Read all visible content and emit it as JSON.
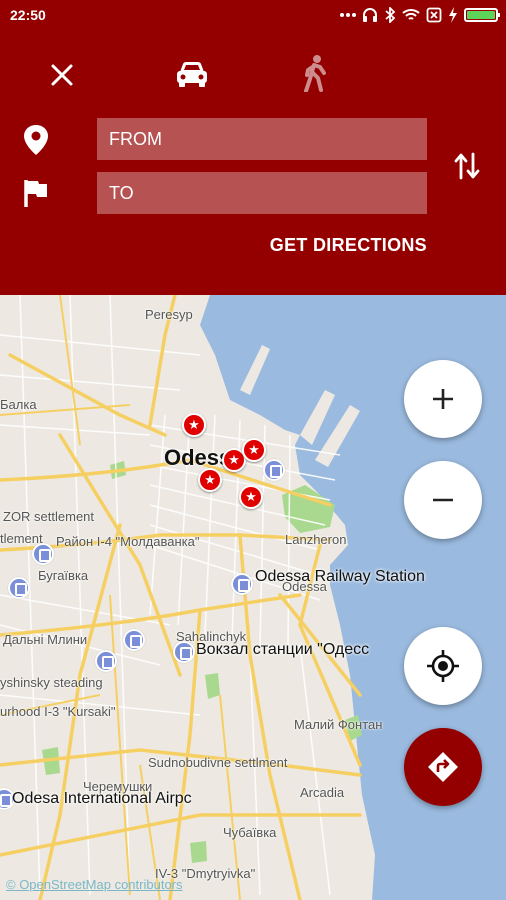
{
  "status_bar": {
    "time": "22:50",
    "more_icon": "more-dots-icon",
    "icons": [
      "headset-icon",
      "bluetooth-icon",
      "wifi-icon",
      "sim-off-icon",
      "charging-icon",
      "battery-icon"
    ],
    "battery_level": 1.0,
    "battery_color": "#5ed35a"
  },
  "header": {
    "background": "#940000",
    "modes": [
      "close-icon",
      "car-icon",
      "walk-icon"
    ],
    "selected_mode": "car",
    "from_placeholder": "FROM",
    "to_placeholder": "TO",
    "get_directions_label": "GET DIRECTIONS"
  },
  "map": {
    "city_label": "Odessa",
    "labels": [
      "Peresyp",
      "Балка",
      "ZOR settlement",
      "tlement",
      "Район І-4 \"Молдаванка\"",
      "Бугаївка",
      "Lanzheron",
      "Odessa",
      "Дальні Млини",
      "Sahalinchyk",
      "yshinsky steading",
      "urhood I-3 \"Kursaki\"",
      "Малий Фонтан",
      "Sudnobudivne settlment",
      "Черемушки",
      "Arcadia",
      "Чубаївка",
      "IV-3 \"Dmytryivka\""
    ],
    "poi_labels": [
      "Odessa Railway Station",
      "Вокзал станции \"Одесс",
      "Odesa International Airpc"
    ],
    "marker_glyph": "★",
    "attribution": "© OpenStreetMap contributors",
    "colors": {
      "sea": "#9abadf",
      "park": "#a9d88f",
      "road": "#f6cf63"
    }
  },
  "controls": {
    "zoom_in": "plus-icon",
    "zoom_out": "minus-icon",
    "locate": "crosshair-icon",
    "route": "directions-icon",
    "route_color": "#940000"
  }
}
